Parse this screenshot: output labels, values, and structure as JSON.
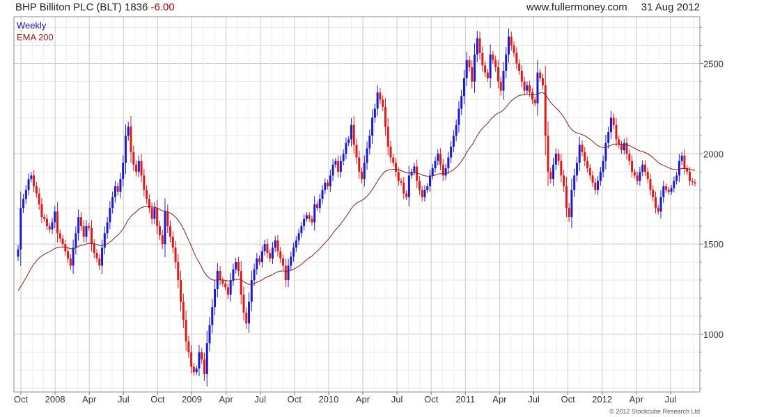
{
  "header": {
    "name": "BHP Billiton PLC (BLT)",
    "last": "1836",
    "change": "-6.00",
    "site": "www.fullermoney.com",
    "date": "31 Aug 2012"
  },
  "footer": {
    "copyright": "© 2012 Stockcube Research Ltd"
  },
  "colors": {
    "up": "#1a1ad6",
    "down": "#e01818",
    "ema": "#8b1a1a",
    "grid": "#c8c8c8",
    "legend_weekly": "#1a1ab0",
    "legend_ema": "#a01818"
  },
  "chart_data": {
    "type": "candlestick",
    "title": "BHP Billiton PLC (BLT)",
    "interval": "Weekly",
    "x_ticks": [
      "Oct",
      "2008",
      "Apr",
      "Jul",
      "Oct",
      "2009",
      "Apr",
      "Jul",
      "Oct",
      "2010",
      "Apr",
      "Jul",
      "Oct",
      "2011",
      "Apr",
      "Jul",
      "Oct",
      "2012",
      "Apr",
      "Jul"
    ],
    "y_ticks": [
      1000,
      1500,
      2000,
      2500
    ],
    "ylim": [
      680,
      2760
    ],
    "grid": true,
    "series": [
      {
        "name": "Weekly",
        "kind": "close"
      },
      {
        "name": "EMA 200",
        "kind": "ema"
      }
    ],
    "close": [
      1470,
      1700,
      1750,
      1800,
      1860,
      1880,
      1820,
      1780,
      1720,
      1650,
      1640,
      1600,
      1580,
      1620,
      1680,
      1560,
      1530,
      1500,
      1460,
      1420,
      1380,
      1480,
      1560,
      1650,
      1600,
      1540,
      1600,
      1590,
      1500,
      1450,
      1420,
      1380,
      1480,
      1560,
      1620,
      1700,
      1760,
      1820,
      1790,
      1860,
      1950,
      2100,
      2150,
      2010,
      1940,
      1900,
      1960,
      1880,
      1800,
      1750,
      1700,
      1640,
      1700,
      1600,
      1550,
      1500,
      1680,
      1600,
      1540,
      1480,
      1400,
      1300,
      1180,
      1080,
      960,
      900,
      820,
      790,
      810,
      900,
      860,
      780,
      950,
      1050,
      1150,
      1250,
      1350,
      1300,
      1280,
      1260,
      1220,
      1300,
      1360,
      1400,
      1350,
      1220,
      1120,
      1060,
      1180,
      1300,
      1360,
      1420,
      1400,
      1460,
      1500,
      1450,
      1420,
      1480,
      1520,
      1460,
      1420,
      1380,
      1300,
      1380,
      1430,
      1480,
      1520,
      1560,
      1600,
      1640,
      1660,
      1640,
      1620,
      1720,
      1700,
      1750,
      1800,
      1840,
      1820,
      1880,
      1940,
      1960,
      1900,
      1960,
      2000,
      2060,
      2080,
      2160,
      2050,
      1980,
      1900,
      1860,
      1950,
      2030,
      2100,
      2200,
      2250,
      2340,
      2300,
      2260,
      2150,
      2040,
      1980,
      1950,
      1900,
      1850,
      1840,
      1780,
      1760,
      1880,
      1900,
      1930,
      1850,
      1800,
      1760,
      1800,
      1820,
      1880,
      1920,
      1960,
      2000,
      1940,
      1880,
      1920,
      1980,
      2040,
      2100,
      2160,
      2250,
      2320,
      2420,
      2520,
      2480,
      2400,
      2550,
      2640,
      2560,
      2490,
      2450,
      2420,
      2550,
      2520,
      2480,
      2400,
      2350,
      2460,
      2550,
      2650,
      2600,
      2560,
      2500,
      2460,
      2400,
      2350,
      2380,
      2340,
      2300,
      2280,
      2450,
      2420,
      2380,
      2100,
      1900,
      1860,
      1940,
      2000,
      1960,
      1880,
      1820,
      1700,
      1650,
      1800,
      1880,
      1950,
      2050,
      2010,
      1960,
      1920,
      1880,
      1840,
      1800,
      1850,
      1900,
      1960,
      2060,
      2120,
      2200,
      2160,
      2080,
      2050,
      2020,
      2060,
      2000,
      1960,
      1900,
      1880,
      1850,
      1900,
      1940,
      1900,
      1860,
      1800,
      1760,
      1700,
      1680,
      1760,
      1820,
      1800,
      1790,
      1810,
      1850,
      1880,
      1960,
      1990,
      1920,
      1900,
      1850,
      1842,
      1836
    ],
    "ema_start": 1230
  }
}
